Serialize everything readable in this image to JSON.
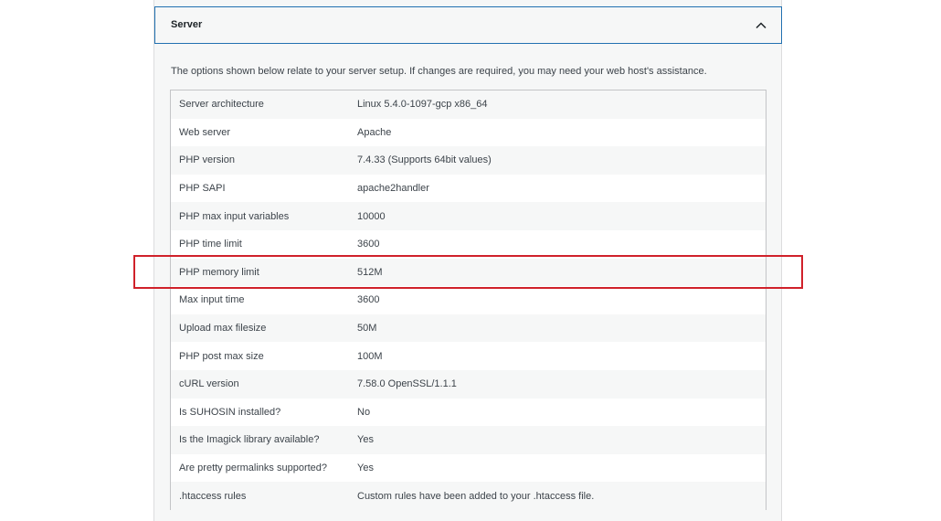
{
  "section": {
    "title": "Server",
    "expanded_icon": "chevron-up-icon",
    "intro": "The options shown below relate to your server setup. If changes are required, you may need your web host's assistance."
  },
  "rows": [
    {
      "label": "Server architecture",
      "value": "Linux 5.4.0-1097-gcp x86_64"
    },
    {
      "label": "Web server",
      "value": "Apache"
    },
    {
      "label": "PHP version",
      "value": "7.4.33 (Supports 64bit values)"
    },
    {
      "label": "PHP SAPI",
      "value": "apache2handler"
    },
    {
      "label": "PHP max input variables",
      "value": "10000"
    },
    {
      "label": "PHP time limit",
      "value": "3600"
    },
    {
      "label": "PHP memory limit",
      "value": "512M"
    },
    {
      "label": "Max input time",
      "value": "3600"
    },
    {
      "label": "Upload max filesize",
      "value": "50M"
    },
    {
      "label": "PHP post max size",
      "value": "100M"
    },
    {
      "label": "cURL version",
      "value": "7.58.0 OpenSSL/1.1.1"
    },
    {
      "label": "Is SUHOSIN installed?",
      "value": "No"
    },
    {
      "label": "Is the Imagick library available?",
      "value": "Yes"
    },
    {
      "label": "Are pretty permalinks supported?",
      "value": "Yes"
    },
    {
      "label": ".htaccess rules",
      "value": "Custom rules have been added to your .htaccess file."
    }
  ],
  "colors": {
    "accent": "#2271b1",
    "highlight": "#d0212a"
  }
}
